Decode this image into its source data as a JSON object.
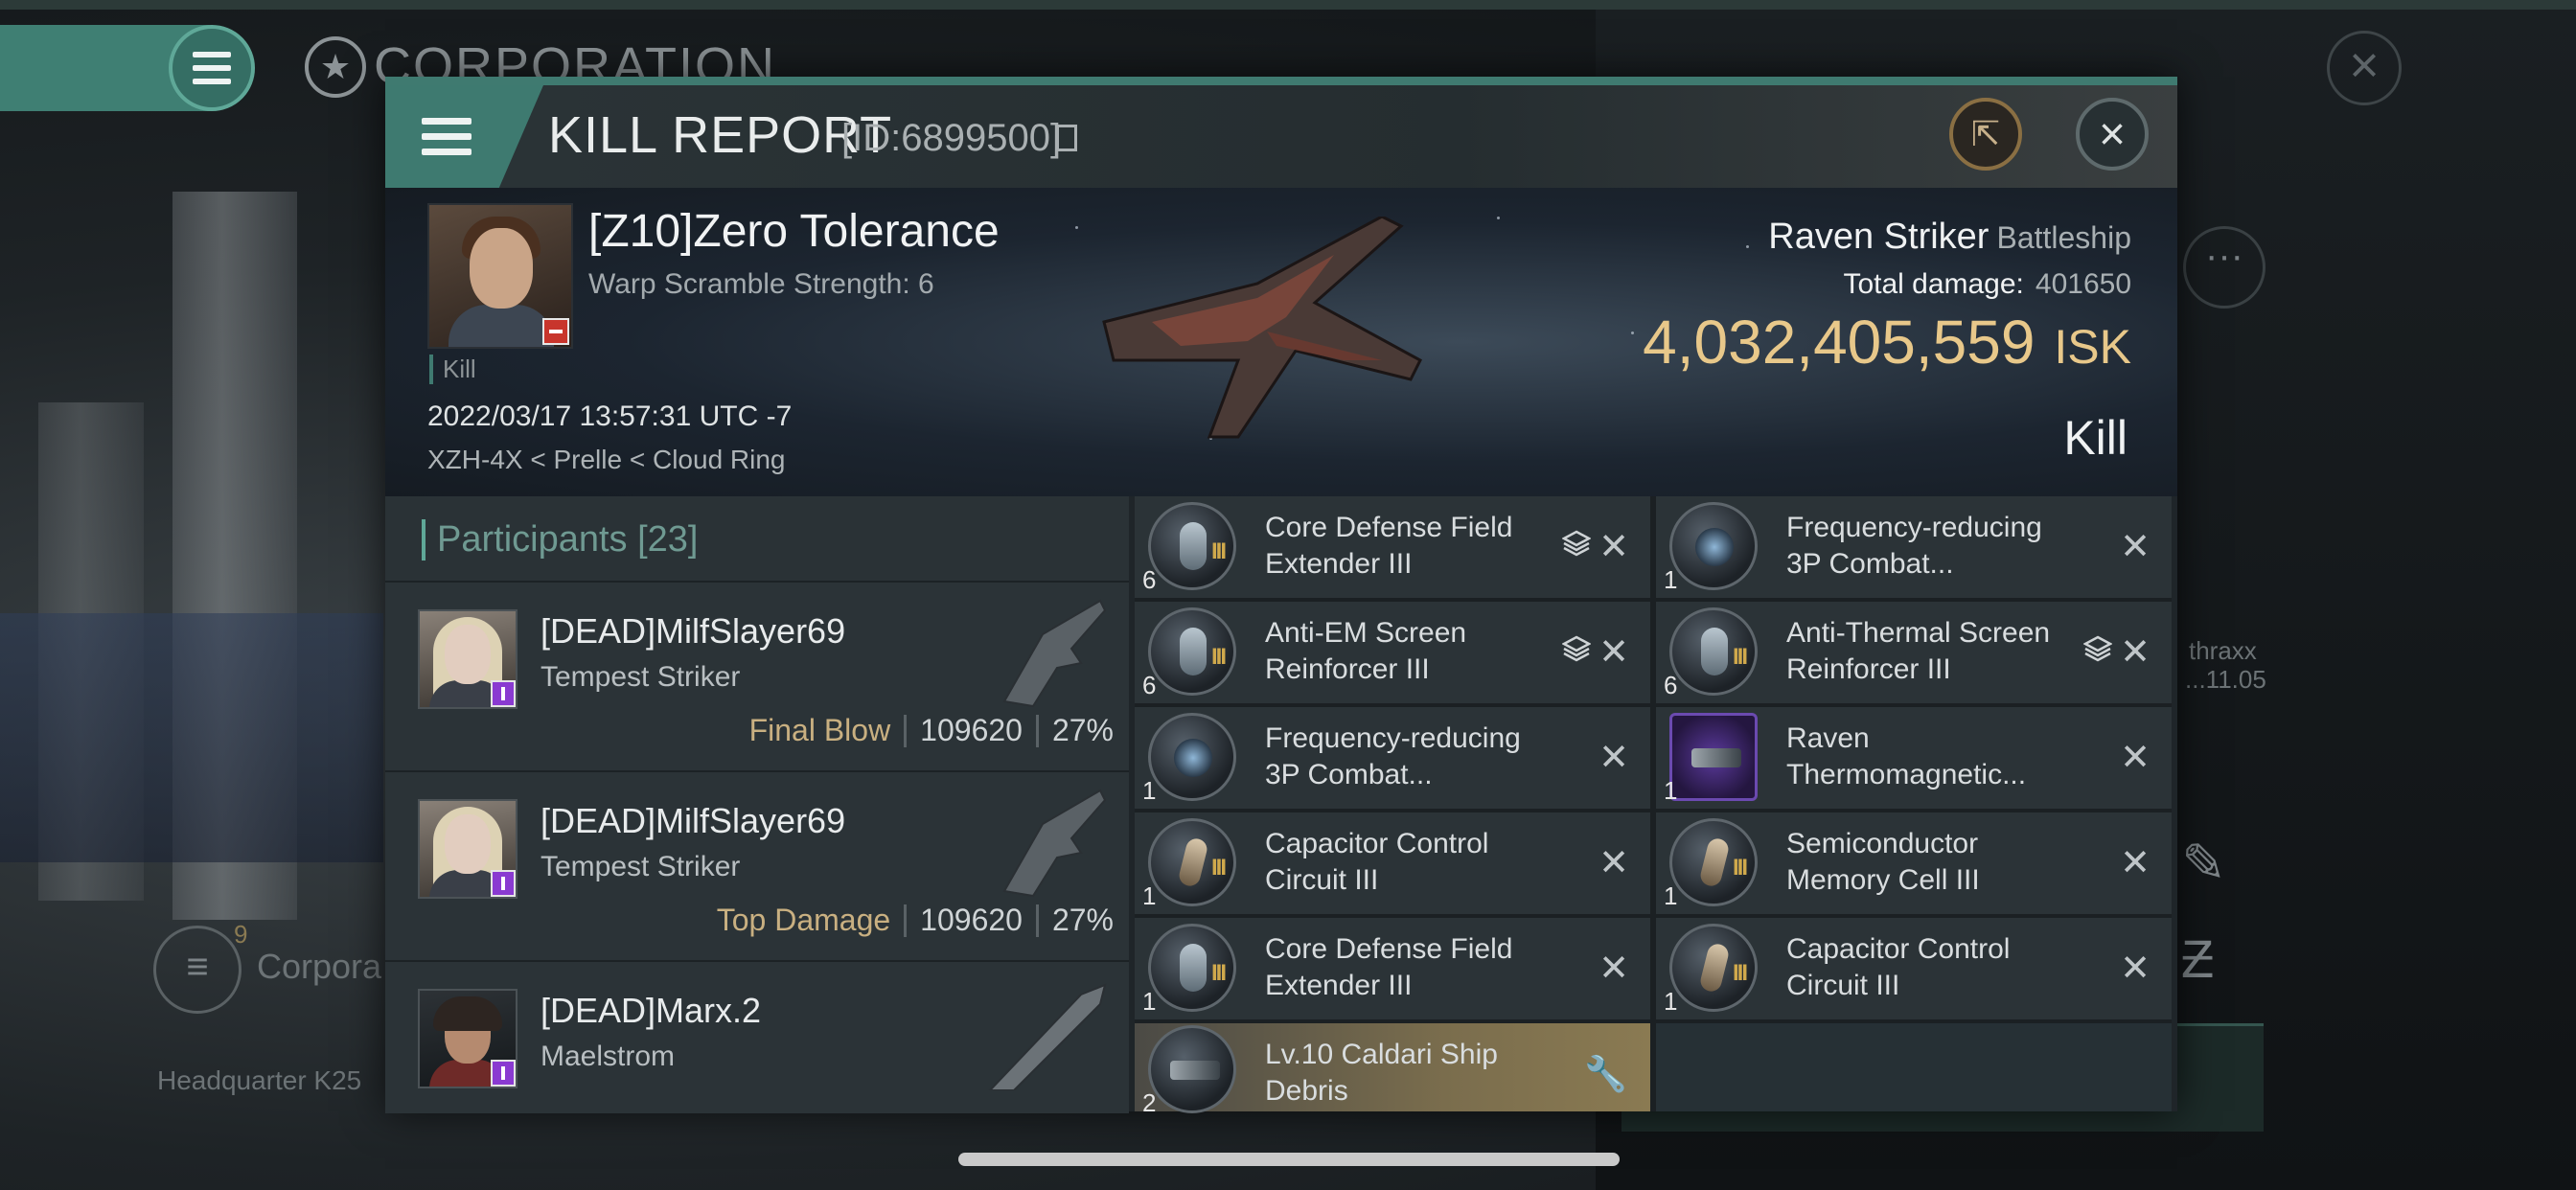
{
  "background": {
    "corporation_title": "CORPORATION",
    "headquarter_label": "Headquarter K25",
    "corp_label": "Corpora",
    "corp_count": "9",
    "side_name": "thraxx",
    "side_date": "...11.05"
  },
  "dialog": {
    "title": "KILL REPORT",
    "id": "[ID:6899500]"
  },
  "victim": {
    "name": "[Z10]Zero Tolerance",
    "warp_scramble": "Warp Scramble Strength: 6",
    "kill_tag": "Kill",
    "datetime": "2022/03/17 13:57:31 UTC -7",
    "location": "XZH-4X < Prelle < Cloud Ring",
    "ship_name": "Raven Striker",
    "ship_class": "Battleship",
    "total_damage_label": "Total damage:",
    "total_damage": "401650",
    "isk_value": "4,032,405,559",
    "isk_unit": "ISK",
    "result": "Kill"
  },
  "participants": {
    "label": "Participants",
    "count": "[23]",
    "rows": [
      {
        "name": "[DEAD]MilfSlayer69",
        "ship": "Tempest Striker",
        "tag": "Final Blow",
        "damage": "109620",
        "percent": "27%"
      },
      {
        "name": "[DEAD]MilfSlayer69",
        "ship": "Tempest Striker",
        "tag": "Top Damage",
        "damage": "109620",
        "percent": "27%"
      },
      {
        "name": "[DEAD]Marx.2",
        "ship": "Maelstrom",
        "tag": "",
        "damage": "",
        "percent": ""
      }
    ]
  },
  "items": [
    {
      "qty": "6",
      "name": "Core Defense Field Extender III",
      "tier": "III"
    },
    {
      "qty": "1",
      "name": "Frequency-reducing 3P Combat...",
      "tier": ""
    },
    {
      "qty": "6",
      "name": "Anti-EM Screen Reinforcer III",
      "tier": "III"
    },
    {
      "qty": "6",
      "name": "Anti-Thermal Screen Reinforcer III",
      "tier": "III"
    },
    {
      "qty": "1",
      "name": "Frequency-reducing 3P Combat...",
      "tier": ""
    },
    {
      "qty": "1",
      "name": "Raven Thermomagnetic...",
      "tier": ""
    },
    {
      "qty": "1",
      "name": "Capacitor Control Circuit III",
      "tier": "III"
    },
    {
      "qty": "1",
      "name": "Semiconductor Memory Cell III",
      "tier": "III"
    },
    {
      "qty": "1",
      "name": "Core Defense Field Extender III",
      "tier": "III"
    },
    {
      "qty": "1",
      "name": "Capacitor Control Circuit III",
      "tier": "III"
    },
    {
      "qty": "2",
      "name": "Lv.10 Caldari Ship Debris",
      "tier": ""
    }
  ],
  "colors": {
    "accent": "#3f7a70",
    "isk_gold": "#e8c88a",
    "final_blow": "#c9b081"
  }
}
